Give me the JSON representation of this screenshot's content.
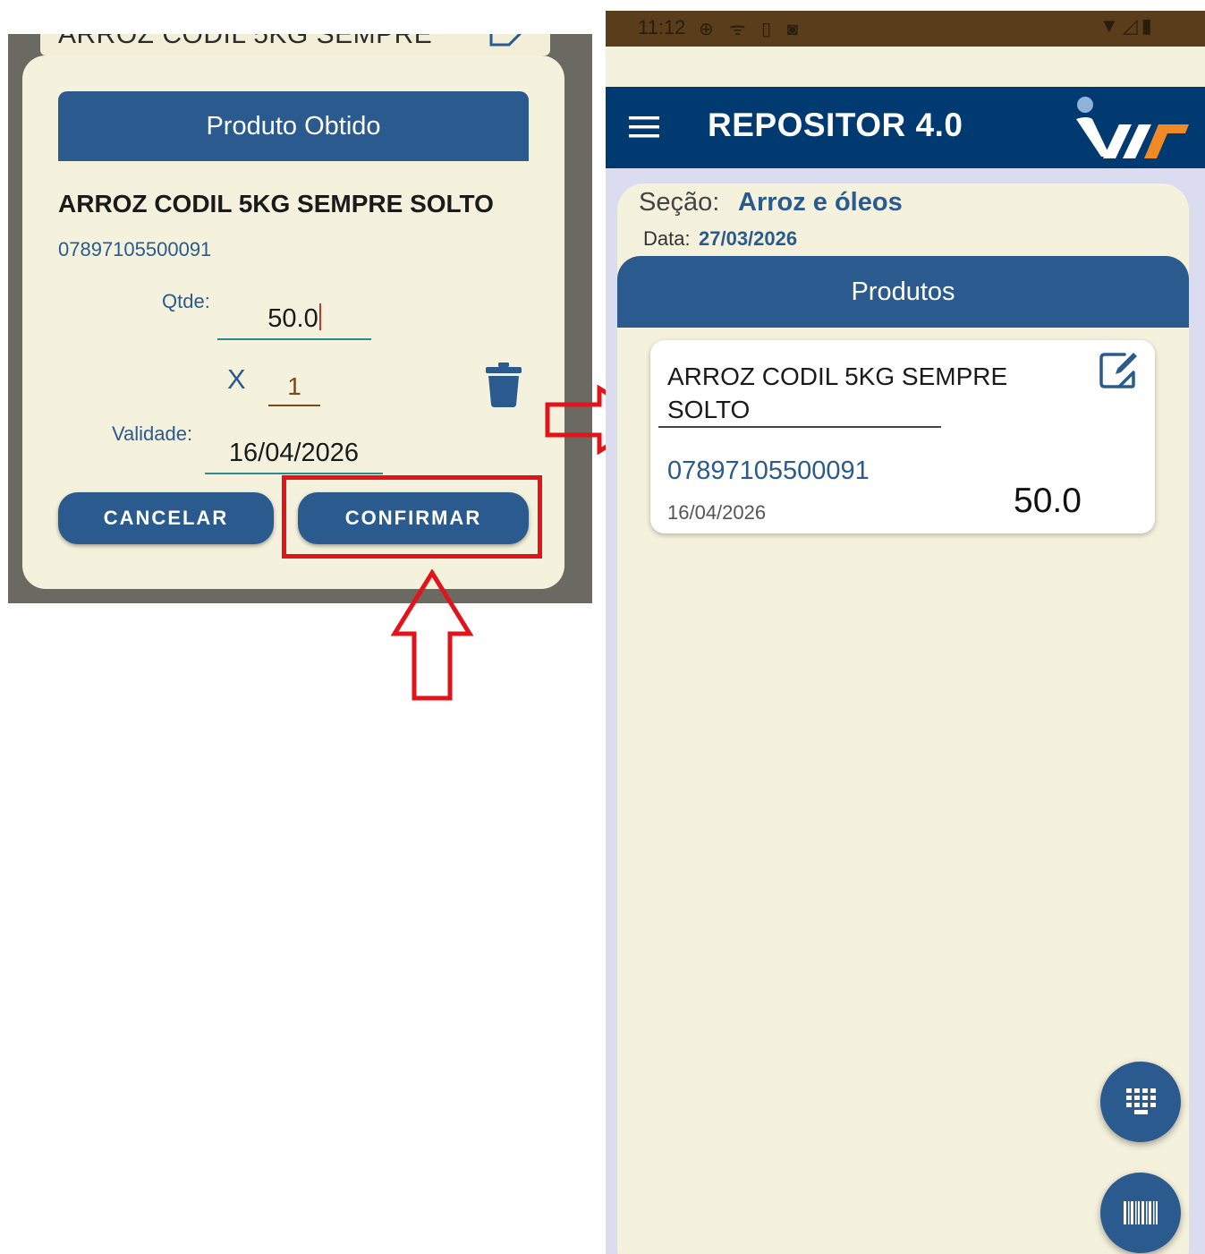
{
  "left_dialog": {
    "bg_card_title": "ARROZ CODIL 5KG SEMPRE",
    "header": "Produto Obtido",
    "product_name": "ARROZ CODIL 5KG SEMPRE SOLTO",
    "barcode": "07897105500091",
    "qty_label": "Qtde:",
    "qty_value": "50.0",
    "multiplier_label": "X",
    "multiplier_value": "1",
    "validade_label": "Validade:",
    "validade_value": "16/04/2026",
    "cancel_label": "CANCELAR",
    "confirm_label": "CONFIRMAR"
  },
  "status_bar": {
    "time": "11:12",
    "icons_left": "⊕ ᯤ ▯ ◙",
    "icons_right": "▼◿▮"
  },
  "app_bar": {
    "title": "REPOSITOR 4.0"
  },
  "section": {
    "secao_label": "Seção:",
    "secao_value": "Arroz e óleos",
    "data_label": "Data:",
    "data_value": "27/03/2026"
  },
  "produtos": {
    "header": "Produtos",
    "items": [
      {
        "name": "ARROZ CODIL 5KG SEMPRE SOLTO",
        "barcode": "07897105500091",
        "date": "16/04/2026",
        "qty": "50.0"
      }
    ]
  },
  "colors": {
    "primary_blue": "#2b5a8e",
    "app_bar_navy": "#003a70",
    "cream_bg": "#f4f1dc",
    "annotation_red": "#e0141a",
    "logo_orange": "#f08a24"
  },
  "icons": {
    "menu": "hamburger-menu-icon",
    "delete": "trash-icon",
    "edit": "edit-note-icon",
    "keypad": "keypad-icon",
    "barcode_scan": "barcode-scan-icon"
  }
}
